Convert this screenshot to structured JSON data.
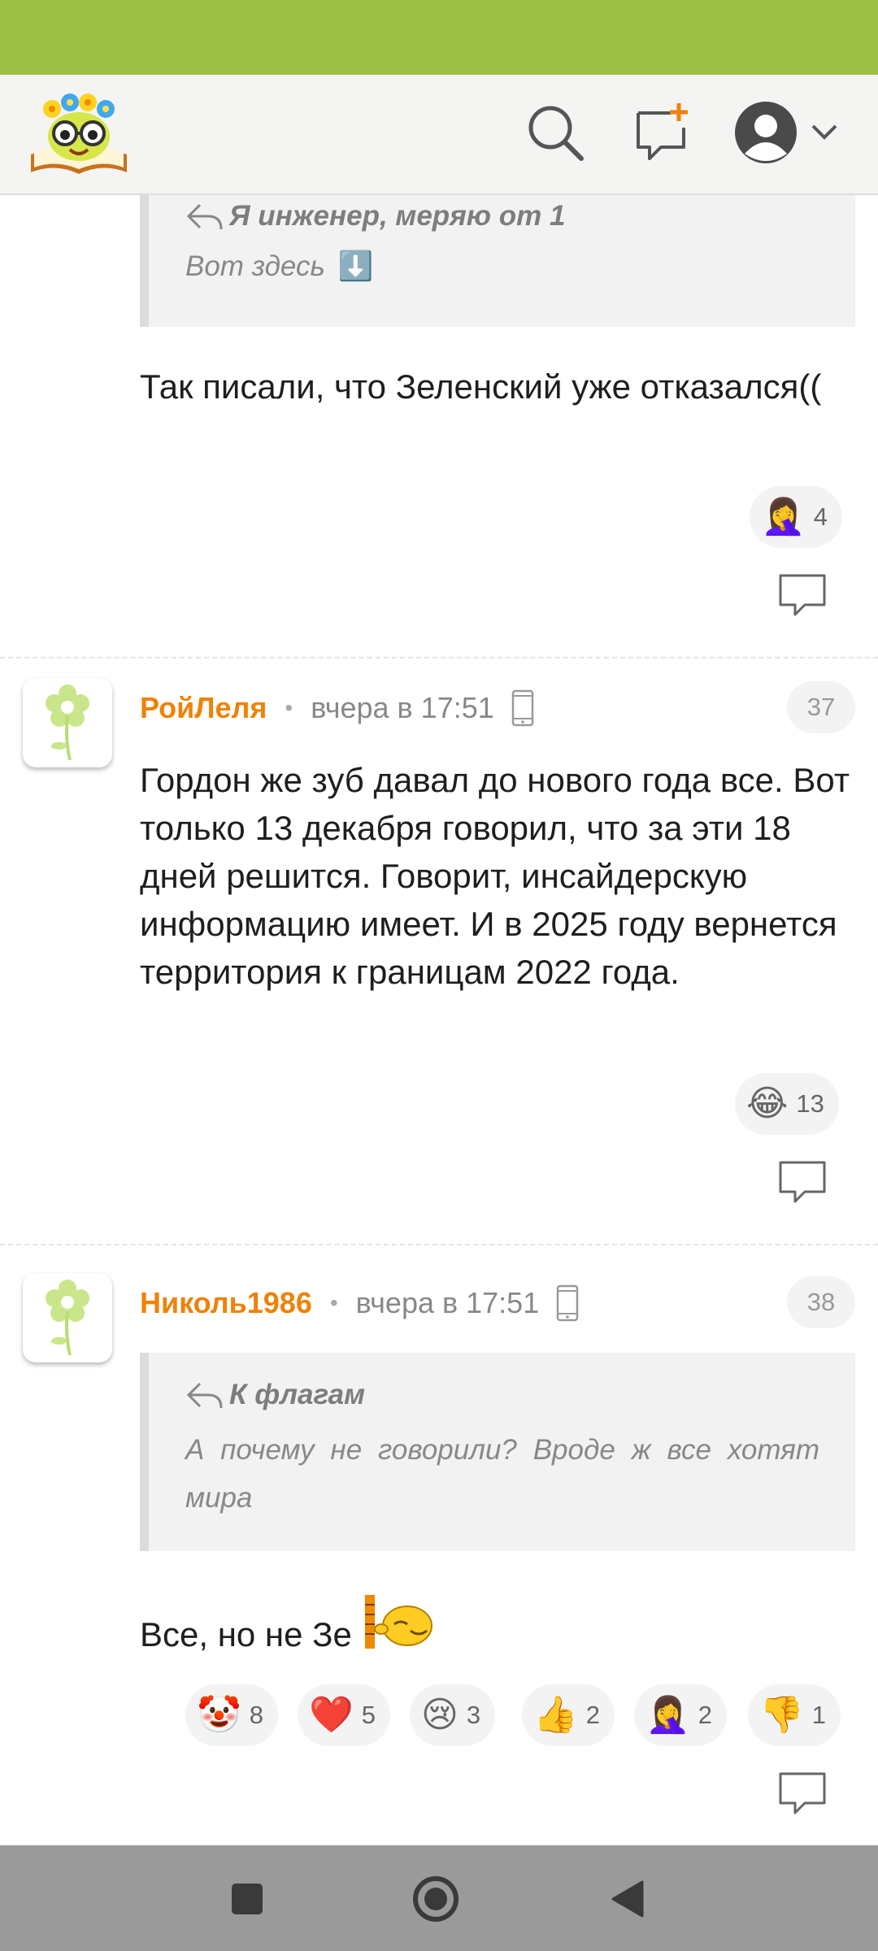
{
  "header": {
    "logo_icon": "book-flowers-logo",
    "search_icon": "search-icon",
    "new_post_icon": "add-comment-icon",
    "profile_icon": "user-avatar-icon",
    "profile_menu_icon": "chevron-down-icon"
  },
  "colors": {
    "status_bar": "#9dc146",
    "author": "#ee8208",
    "nav_bar": "#9a9a9a"
  },
  "comment_top": {
    "quote_author": "Я инженер, меряю от 1",
    "quote_text": "Вот здесь",
    "quote_emoji": "⬇️",
    "text": "Так писали, что Зеленский уже отказался((",
    "reactions": [
      {
        "emoji": "🤦‍♀️",
        "count": "4"
      }
    ]
  },
  "comment_37": {
    "author": "РойЛеля",
    "separator": "•",
    "time": "вчера в 17:51",
    "number": "37",
    "text": "Гордон же зуб давал до нового года все. Вот только 13 декабря говорил, что за эти 18 дней решится. Говорит, инсайдерскую информацию имеет. И в 2025 году вернется территория к границам 2022 года.",
    "reactions": [
      {
        "emoji": "😂",
        "count": "13"
      }
    ]
  },
  "comment_38": {
    "author": "Николь1986",
    "separator": "•",
    "time": "вчера в 17:51",
    "number": "38",
    "quote_author": "К флагам",
    "quote_text": "А почему не говорили? Вроде ж все хотят мира",
    "text": "Все, но не Зе",
    "reactions": [
      {
        "emoji": "🤡",
        "count": "8"
      },
      {
        "emoji": "❤️",
        "count": "5"
      },
      {
        "emoji": "😢",
        "count": "3"
      },
      {
        "emoji": "👍",
        "count": "2"
      },
      {
        "emoji": "🤦‍♀️",
        "count": "2"
      },
      {
        "emoji": "👎",
        "count": "1"
      }
    ]
  }
}
